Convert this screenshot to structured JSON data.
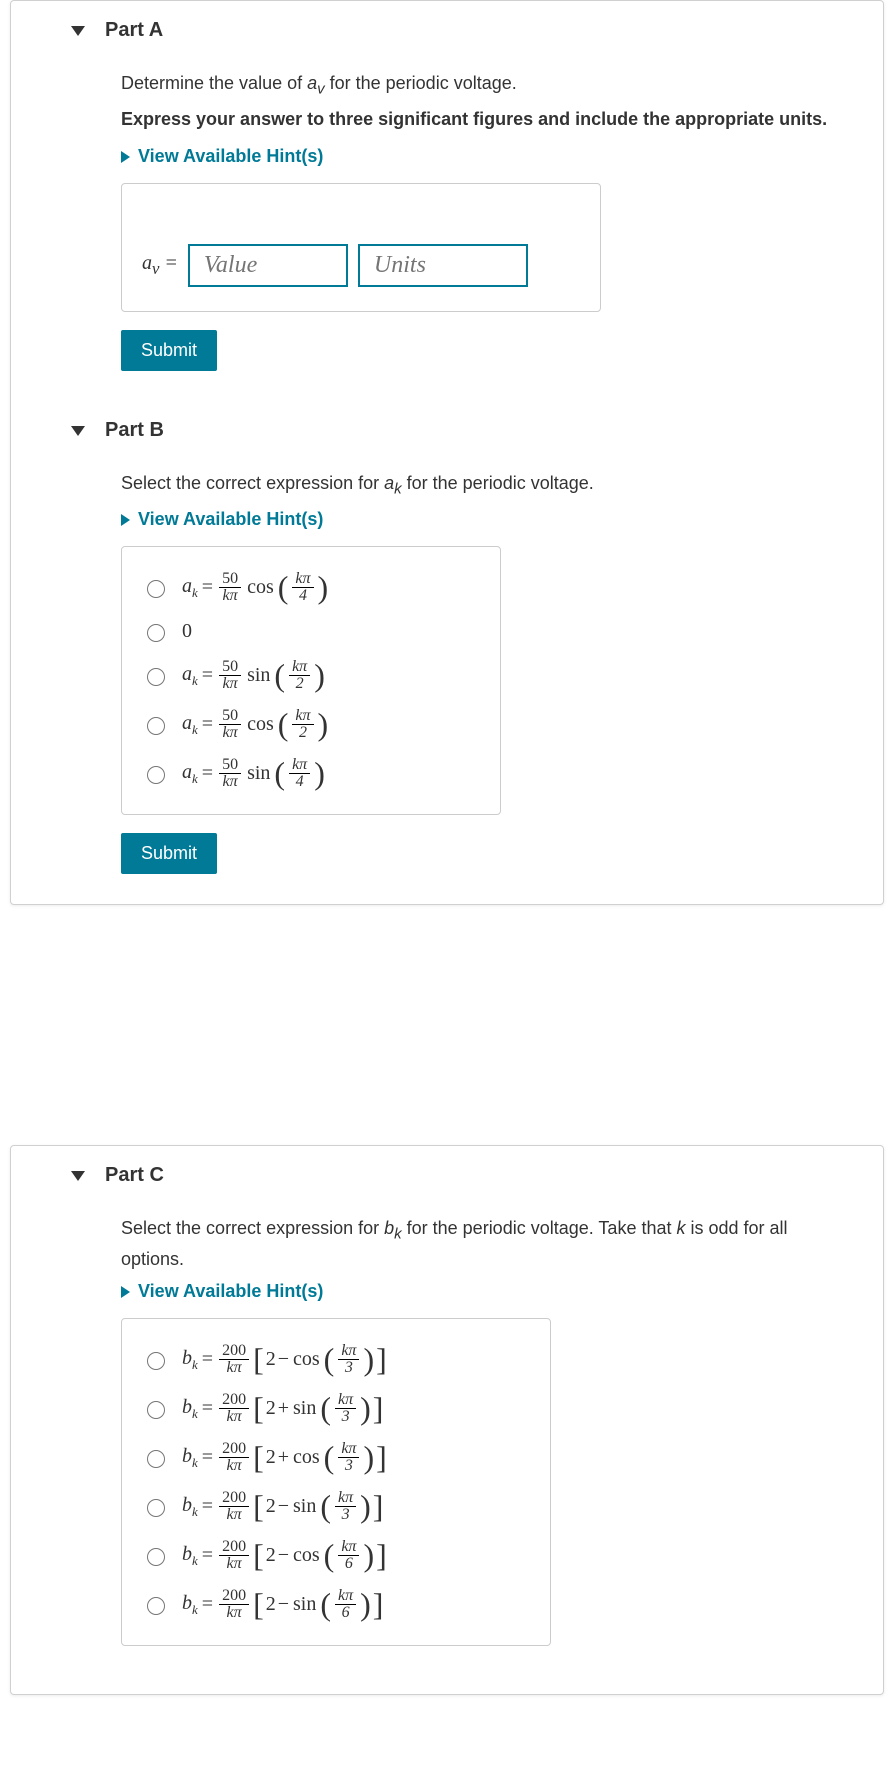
{
  "partA": {
    "title": "Part A",
    "instruction": "Determine the value of aᵥ for the periodic voltage.",
    "directive": "Express your answer to three significant figures and include the appropriate units.",
    "hints": "View Available Hint(s)",
    "label_prefix": "aᵥ =",
    "value_placeholder": "Value",
    "units_placeholder": "Units",
    "submit": "Submit"
  },
  "partB": {
    "title": "Part B",
    "instruction": "Select the correct expression for aₖ for the periodic voltage.",
    "hints": "View Available Hint(s)",
    "options": [
      {
        "var": "a",
        "coef_num": "50",
        "coef_den": "kπ",
        "fn": "cos",
        "arg_num": "kπ",
        "arg_den": "4"
      },
      {
        "plain": "0"
      },
      {
        "var": "a",
        "coef_num": "50",
        "coef_den": "kπ",
        "fn": "sin",
        "arg_num": "kπ",
        "arg_den": "2"
      },
      {
        "var": "a",
        "coef_num": "50",
        "coef_den": "kπ",
        "fn": "cos",
        "arg_num": "kπ",
        "arg_den": "2"
      },
      {
        "var": "a",
        "coef_num": "50",
        "coef_den": "kπ",
        "fn": "sin",
        "arg_num": "kπ",
        "arg_den": "4"
      }
    ],
    "submit": "Submit"
  },
  "partC": {
    "title": "Part C",
    "instruction": "Select the correct expression for bₖ for the periodic voltage. Take that k is odd for all options.",
    "hints": "View Available Hint(s)",
    "options": [
      {
        "var": "b",
        "coef_num": "200",
        "coef_den": "kπ",
        "inner_const": "2",
        "op": "−",
        "fn": "cos",
        "arg_num": "kπ",
        "arg_den": "3"
      },
      {
        "var": "b",
        "coef_num": "200",
        "coef_den": "kπ",
        "inner_const": "2",
        "op": "+",
        "fn": "sin",
        "arg_num": "kπ",
        "arg_den": "3"
      },
      {
        "var": "b",
        "coef_num": "200",
        "coef_den": "kπ",
        "inner_const": "2",
        "op": "+",
        "fn": "cos",
        "arg_num": "kπ",
        "arg_den": "3"
      },
      {
        "var": "b",
        "coef_num": "200",
        "coef_den": "kπ",
        "inner_const": "2",
        "op": "−",
        "fn": "sin",
        "arg_num": "kπ",
        "arg_den": "3"
      },
      {
        "var": "b",
        "coef_num": "200",
        "coef_den": "kπ",
        "inner_const": "2",
        "op": "−",
        "fn": "cos",
        "arg_num": "kπ",
        "arg_den": "6"
      },
      {
        "var": "b",
        "coef_num": "200",
        "coef_den": "kπ",
        "inner_const": "2",
        "op": "−",
        "fn": "sin",
        "arg_num": "kπ",
        "arg_den": "6"
      }
    ]
  }
}
